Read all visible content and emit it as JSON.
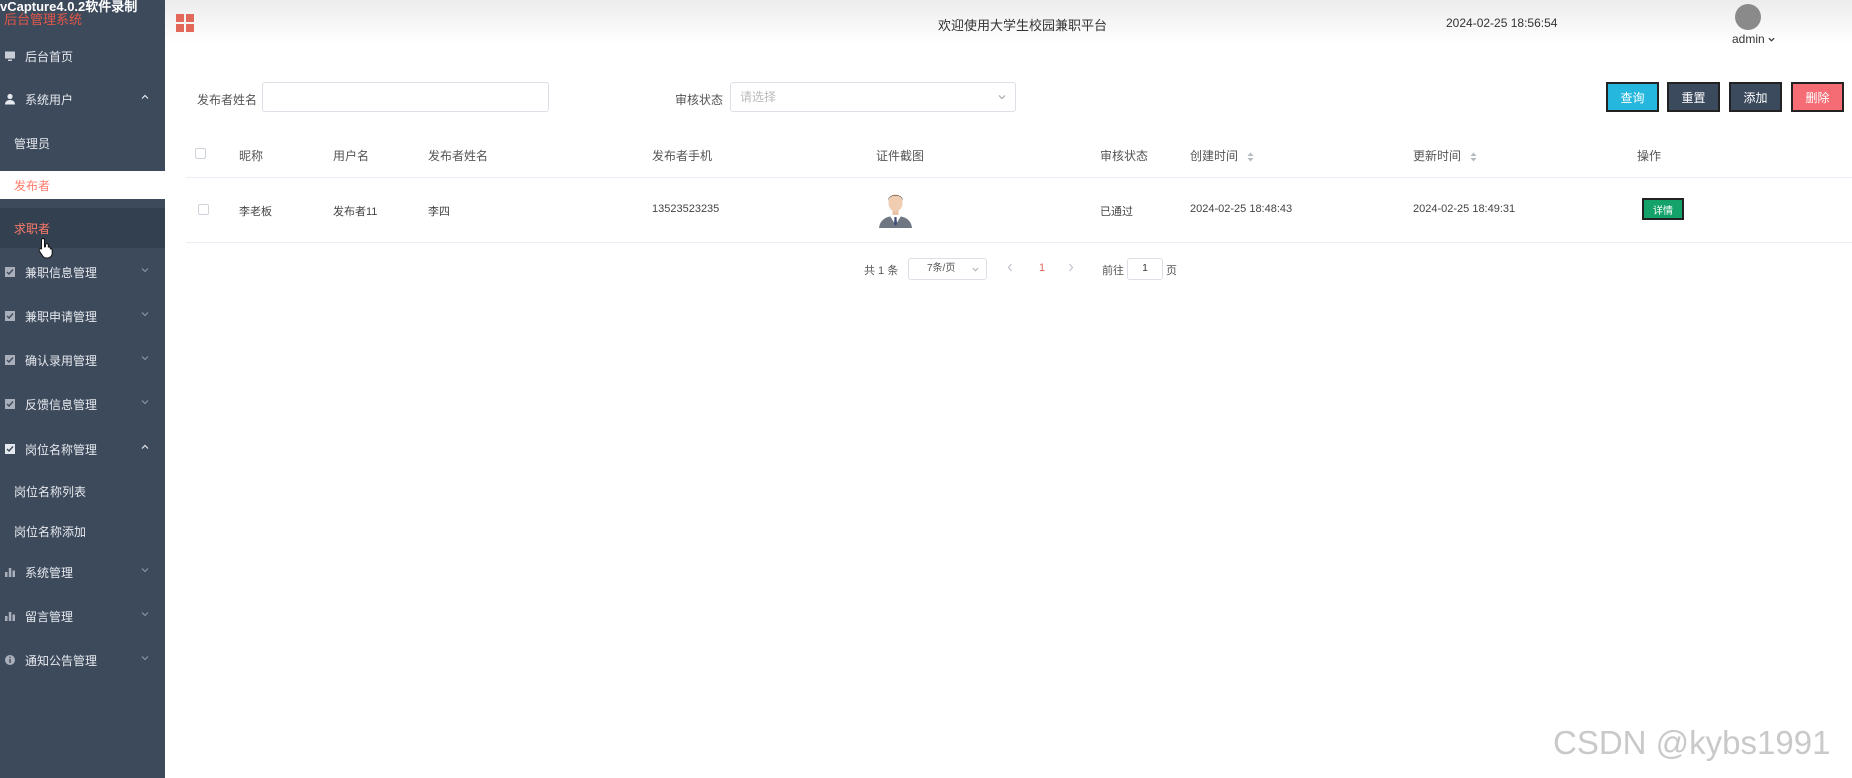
{
  "sidebar": {
    "title_overlay": "vCapture4.0.2软件录制",
    "system_name": "后台管理系统",
    "home": "后台首页",
    "system_users": "系统用户",
    "admins": "管理员",
    "publisher": "发布者",
    "job_seeker": "求职者",
    "part_time_info": "兼职信息管理",
    "part_time_apply": "兼职申请管理",
    "confirm_hire": "确认录用管理",
    "feedback": "反馈信息管理",
    "position_name": "岗位名称管理",
    "position_list": "岗位名称列表",
    "position_add": "岗位名称添加",
    "system_manage": "系统管理",
    "message_manage": "留言管理",
    "notice_manage": "通知公告管理"
  },
  "header": {
    "welcome": "欢迎使用大学生校园兼职平台",
    "datetime": "2024-02-25 18:56:54",
    "username": "admin"
  },
  "search": {
    "publisher_name_label": "发布者姓名",
    "publisher_name_value": "",
    "audit_status_label": "审核状态",
    "audit_status_placeholder": "请选择",
    "query": "查询",
    "reset": "重置",
    "add": "添加",
    "delete": "删除"
  },
  "colors": {
    "query": "#26b7de",
    "reset": "#3c4a5e",
    "add": "#3c4a5e",
    "delete": "#f56c74",
    "detail": "#14a26a",
    "sidebar": "#3d4a5c",
    "active_link": "#ff7b6b"
  },
  "table": {
    "headers": {
      "nickname": "昵称",
      "username": "用户名",
      "publisher_name": "发布者姓名",
      "publisher_phone": "发布者手机",
      "id_screenshot": "证件截图",
      "audit_status": "审核状态",
      "created": "创建时间",
      "updated": "更新时间",
      "actions": "操作"
    },
    "rows": [
      {
        "nickname": "李老板",
        "username": "发布者11",
        "publisher_name": "李四",
        "phone": "13523523235",
        "audit_status": "已通过",
        "created": "2024-02-25 18:48:43",
        "updated": "2024-02-25 18:49:31",
        "action": "详情"
      }
    ]
  },
  "pagination": {
    "total": "共 1 条",
    "page_size": "7条/页",
    "current_page": "1",
    "goto_label": "前往",
    "goto_value": "1",
    "page_suffix": "页"
  },
  "watermark": "CSDN @kybs1991"
}
